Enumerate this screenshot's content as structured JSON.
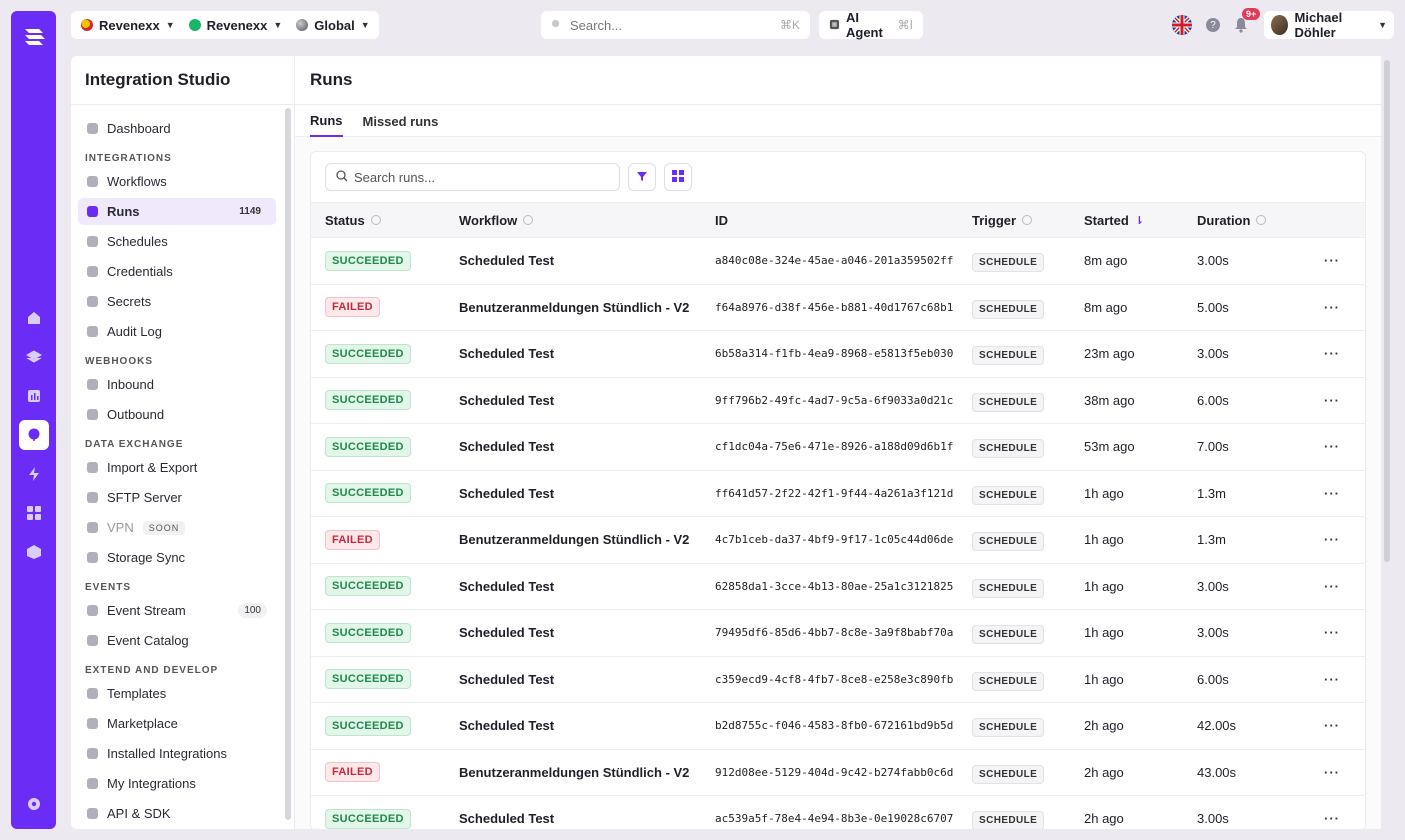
{
  "topbar": {
    "org1": "Revenexx",
    "org2": "Revenexx",
    "scope": "Global",
    "search_placeholder": "Search...",
    "search_shortcut": "⌘K",
    "agent_label": "AI Agent",
    "agent_shortcut": "⌘I",
    "notifications_badge": "9+",
    "user_name": "Michael Döhler"
  },
  "sidebar": {
    "title": "Integration Studio",
    "dashboard": "Dashboard",
    "sections": [
      {
        "label": "INTEGRATIONS",
        "items": [
          {
            "label": "Workflows"
          },
          {
            "label": "Runs",
            "count": "1149",
            "active": true
          },
          {
            "label": "Schedules"
          },
          {
            "label": "Credentials"
          },
          {
            "label": "Secrets"
          },
          {
            "label": "Audit Log"
          }
        ]
      },
      {
        "label": "WEBHOOKS",
        "items": [
          {
            "label": "Inbound"
          },
          {
            "label": "Outbound"
          }
        ]
      },
      {
        "label": "DATA EXCHANGE",
        "items": [
          {
            "label": "Import & Export"
          },
          {
            "label": "SFTP Server"
          },
          {
            "label": "VPN",
            "tag": "SOON"
          },
          {
            "label": "Storage Sync"
          }
        ]
      },
      {
        "label": "EVENTS",
        "items": [
          {
            "label": "Event Stream",
            "count": "100"
          },
          {
            "label": "Event Catalog"
          }
        ]
      },
      {
        "label": "EXTEND AND DEVELOP",
        "items": [
          {
            "label": "Templates"
          },
          {
            "label": "Marketplace"
          },
          {
            "label": "Installed Integrations"
          },
          {
            "label": "My Integrations"
          },
          {
            "label": "API & SDK"
          }
        ]
      }
    ]
  },
  "main": {
    "title": "Runs",
    "tabs": [
      "Runs",
      "Missed runs"
    ],
    "search_placeholder": "Search runs...",
    "columns": {
      "status": "Status",
      "workflow": "Workflow",
      "id": "ID",
      "trigger": "Trigger",
      "started": "Started",
      "duration": "Duration"
    },
    "rows": [
      {
        "status": "SUCCEEDED",
        "workflow": "Scheduled Test",
        "id": "a840c08e-324e-45ae-a046-201a359502ff",
        "trigger": "SCHEDULE",
        "started": "8m ago",
        "duration": "3.00s"
      },
      {
        "status": "FAILED",
        "workflow": "Benutzeranmeldungen Stündlich - V2",
        "id": "f64a8976-d38f-456e-b881-40d1767c68b1",
        "trigger": "SCHEDULE",
        "started": "8m ago",
        "duration": "5.00s"
      },
      {
        "status": "SUCCEEDED",
        "workflow": "Scheduled Test",
        "id": "6b58a314-f1fb-4ea9-8968-e5813f5eb030",
        "trigger": "SCHEDULE",
        "started": "23m ago",
        "duration": "3.00s"
      },
      {
        "status": "SUCCEEDED",
        "workflow": "Scheduled Test",
        "id": "9ff796b2-49fc-4ad7-9c5a-6f9033a0d21c",
        "trigger": "SCHEDULE",
        "started": "38m ago",
        "duration": "6.00s"
      },
      {
        "status": "SUCCEEDED",
        "workflow": "Scheduled Test",
        "id": "cf1dc04a-75e6-471e-8926-a188d09d6b1f",
        "trigger": "SCHEDULE",
        "started": "53m ago",
        "duration": "7.00s"
      },
      {
        "status": "SUCCEEDED",
        "workflow": "Scheduled Test",
        "id": "ff641d57-2f22-42f1-9f44-4a261a3f121d",
        "trigger": "SCHEDULE",
        "started": "1h ago",
        "duration": "1.3m"
      },
      {
        "status": "FAILED",
        "workflow": "Benutzeranmeldungen Stündlich - V2",
        "id": "4c7b1ceb-da37-4bf9-9f17-1c05c44d06de",
        "trigger": "SCHEDULE",
        "started": "1h ago",
        "duration": "1.3m"
      },
      {
        "status": "SUCCEEDED",
        "workflow": "Scheduled Test",
        "id": "62858da1-3cce-4b13-80ae-25a1c3121825",
        "trigger": "SCHEDULE",
        "started": "1h ago",
        "duration": "3.00s"
      },
      {
        "status": "SUCCEEDED",
        "workflow": "Scheduled Test",
        "id": "79495df6-85d6-4bb7-8c8e-3a9f8babf70a",
        "trigger": "SCHEDULE",
        "started": "1h ago",
        "duration": "3.00s"
      },
      {
        "status": "SUCCEEDED",
        "workflow": "Scheduled Test",
        "id": "c359ecd9-4cf8-4fb7-8ce8-e258e3c890fb",
        "trigger": "SCHEDULE",
        "started": "1h ago",
        "duration": "6.00s"
      },
      {
        "status": "SUCCEEDED",
        "workflow": "Scheduled Test",
        "id": "b2d8755c-f046-4583-8fb0-672161bd9b5d",
        "trigger": "SCHEDULE",
        "started": "2h ago",
        "duration": "42.00s"
      },
      {
        "status": "FAILED",
        "workflow": "Benutzeranmeldungen Stündlich - V2",
        "id": "912d08ee-5129-404d-9c42-b274fabb0c6d",
        "trigger": "SCHEDULE",
        "started": "2h ago",
        "duration": "43.00s"
      },
      {
        "status": "SUCCEEDED",
        "workflow": "Scheduled Test",
        "id": "ac539a5f-78e4-4e94-8b3e-0e19028c6707",
        "trigger": "SCHEDULE",
        "started": "2h ago",
        "duration": "3.00s"
      }
    ]
  },
  "colors": {
    "accent": "#6b2cf5",
    "success": "#1f8a4a",
    "failed": "#c5283d"
  }
}
